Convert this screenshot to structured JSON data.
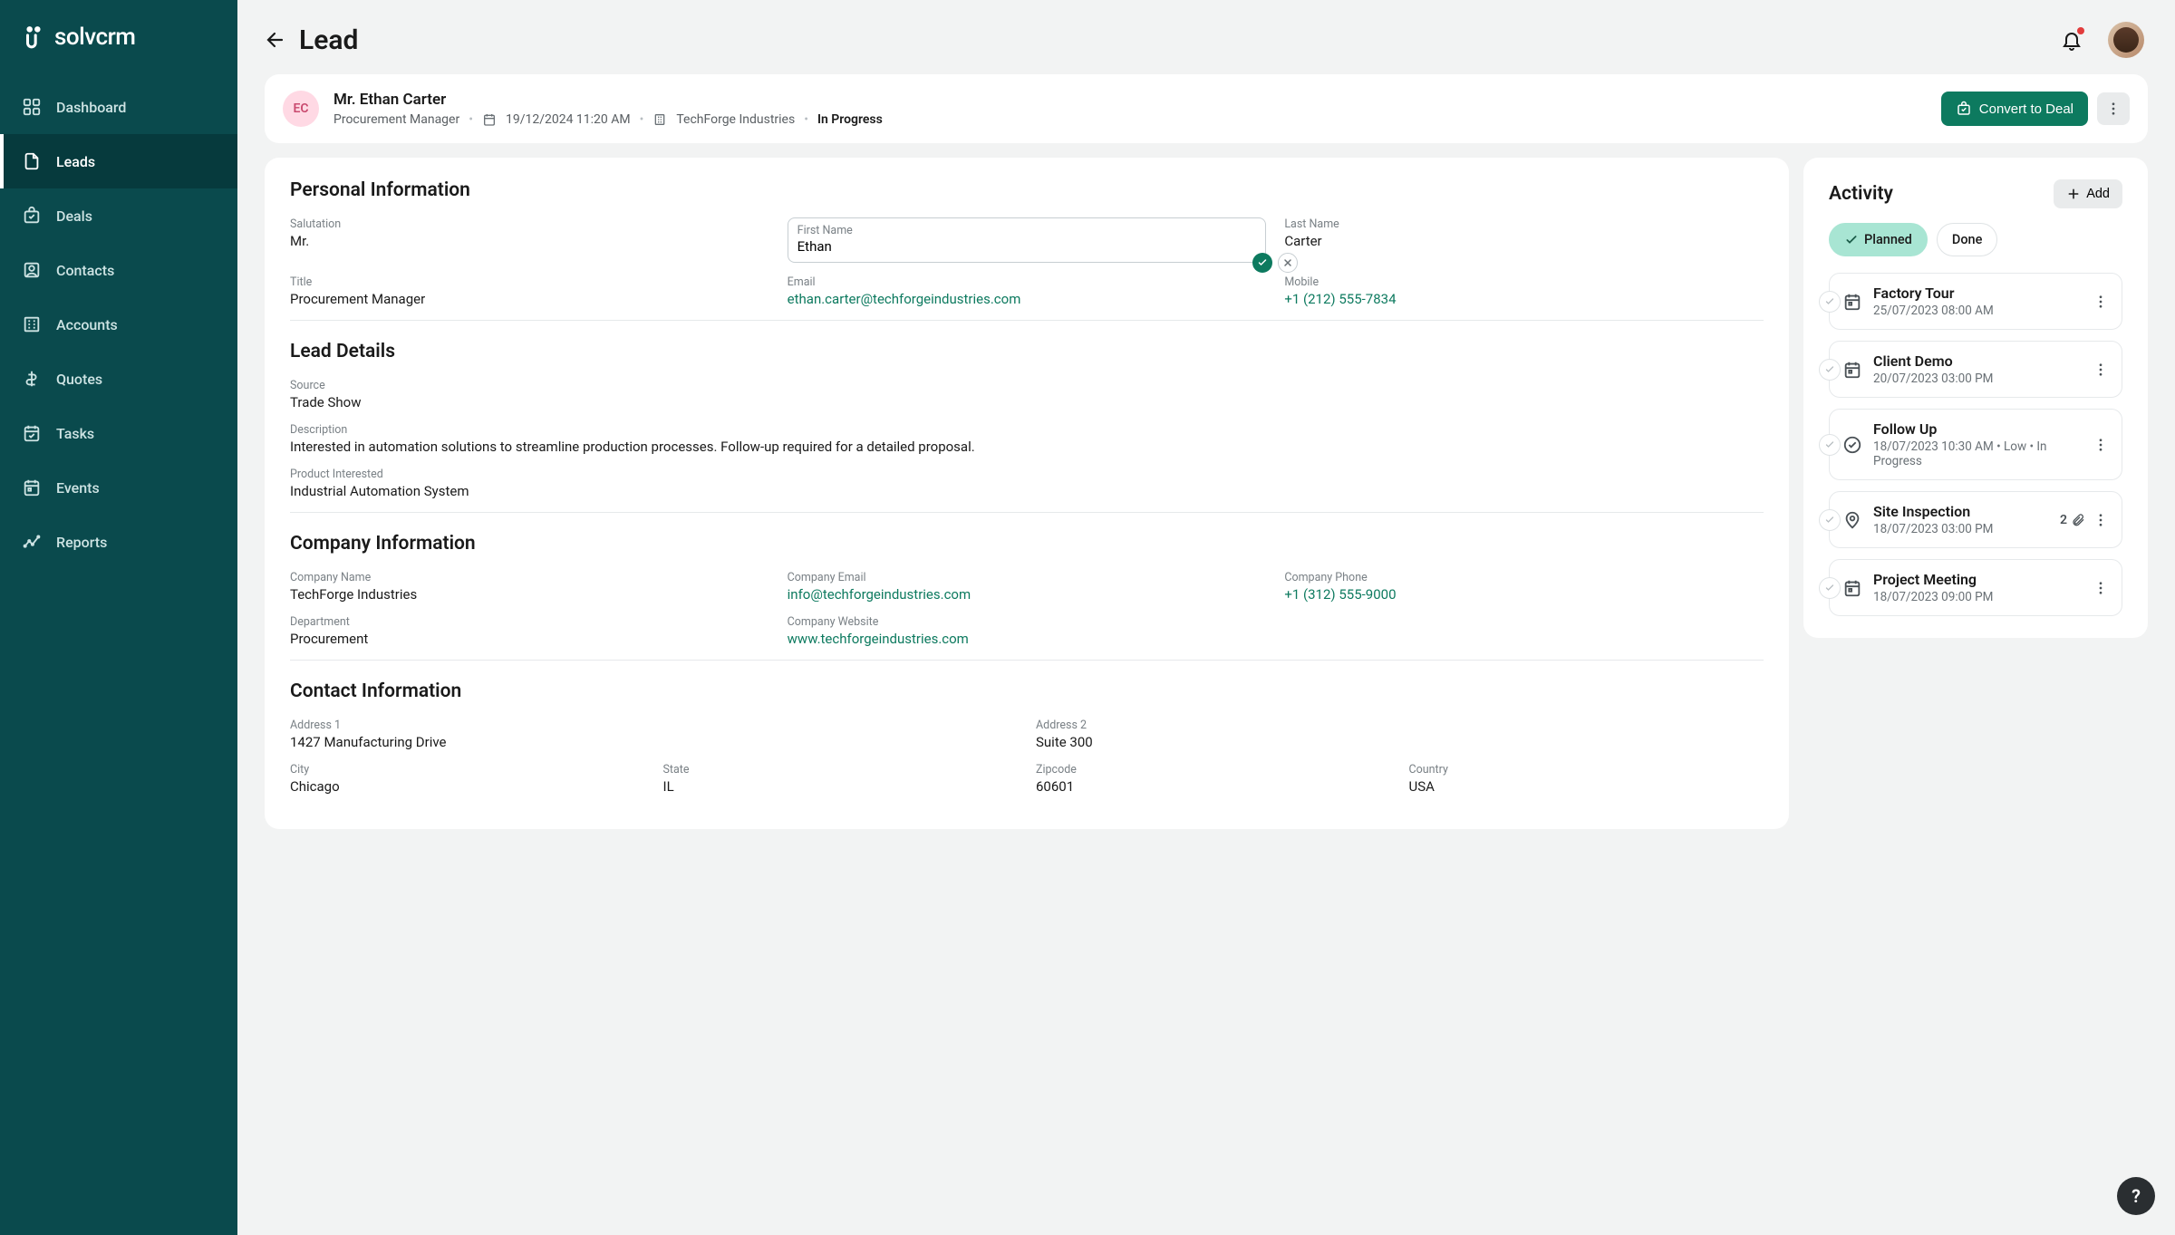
{
  "brand": {
    "name": "solvcrm"
  },
  "nav": {
    "items": [
      {
        "label": "Dashboard"
      },
      {
        "label": "Leads"
      },
      {
        "label": "Deals"
      },
      {
        "label": "Contacts"
      },
      {
        "label": "Accounts"
      },
      {
        "label": "Quotes"
      },
      {
        "label": "Tasks"
      },
      {
        "label": "Events"
      },
      {
        "label": "Reports"
      }
    ]
  },
  "page": {
    "title": "Lead"
  },
  "lead": {
    "initials": "EC",
    "full_name": "Mr. Ethan Carter",
    "role": "Procurement Manager",
    "created": "19/12/2024 11:20 AM",
    "company": "TechForge Industries",
    "status": "In Progress",
    "convert_label": "Convert to Deal"
  },
  "sections": {
    "personal_title": "Personal Information",
    "lead_details_title": "Lead Details",
    "company_title": "Company Information",
    "contact_title": "Contact Information"
  },
  "personal": {
    "salutation_label": "Salutation",
    "salutation": "Mr.",
    "first_name_label": "First Name",
    "first_name": "Ethan",
    "last_name_label": "Last Name",
    "last_name": "Carter",
    "title_label": "Title",
    "title": "Procurement Manager",
    "email_label": "Email",
    "email": "ethan.carter@techforgeindustries.com",
    "mobile_label": "Mobile",
    "mobile": "+1 (212) 555-7834"
  },
  "lead_details": {
    "source_label": "Source",
    "source": "Trade Show",
    "description_label": "Description",
    "description": "Interested in automation solutions to streamline production processes. Follow-up required for a detailed proposal.",
    "product_label": "Product Interested",
    "product": "Industrial Automation System"
  },
  "company": {
    "name_label": "Company Name",
    "name": "TechForge Industries",
    "email_label": "Company Email",
    "email": "info@techforgeindustries.com",
    "phone_label": "Company Phone",
    "phone": "+1 (312) 555-9000",
    "department_label": "Department",
    "department": "Procurement",
    "website_label": "Company Website",
    "website": "www.techforgeindustries.com"
  },
  "contact": {
    "address1_label": "Address 1",
    "address1": "1427 Manufacturing Drive",
    "address2_label": "Address 2",
    "address2": "Suite 300",
    "city_label": "City",
    "city": "Chicago",
    "state_label": "State",
    "state": "IL",
    "zipcode_label": "Zipcode",
    "zipcode": "60601",
    "country_label": "Country",
    "country": "USA"
  },
  "activity": {
    "title": "Activity",
    "add_label": "Add",
    "tabs": {
      "planned": "Planned",
      "done": "Done"
    },
    "items": [
      {
        "title": "Factory Tour",
        "meta": "25/07/2023 08:00 AM"
      },
      {
        "title": "Client Demo",
        "meta": "20/07/2023 03:00 PM"
      },
      {
        "title": "Follow Up",
        "meta": "18/07/2023 10:30 AM  •  Low  •  In Progress"
      },
      {
        "title": "Site Inspection",
        "meta": "18/07/2023 03:00 PM",
        "attachments": "2"
      },
      {
        "title": "Project Meeting",
        "meta": "18/07/2023 09:00 PM"
      }
    ]
  },
  "help": {
    "label": "?"
  }
}
